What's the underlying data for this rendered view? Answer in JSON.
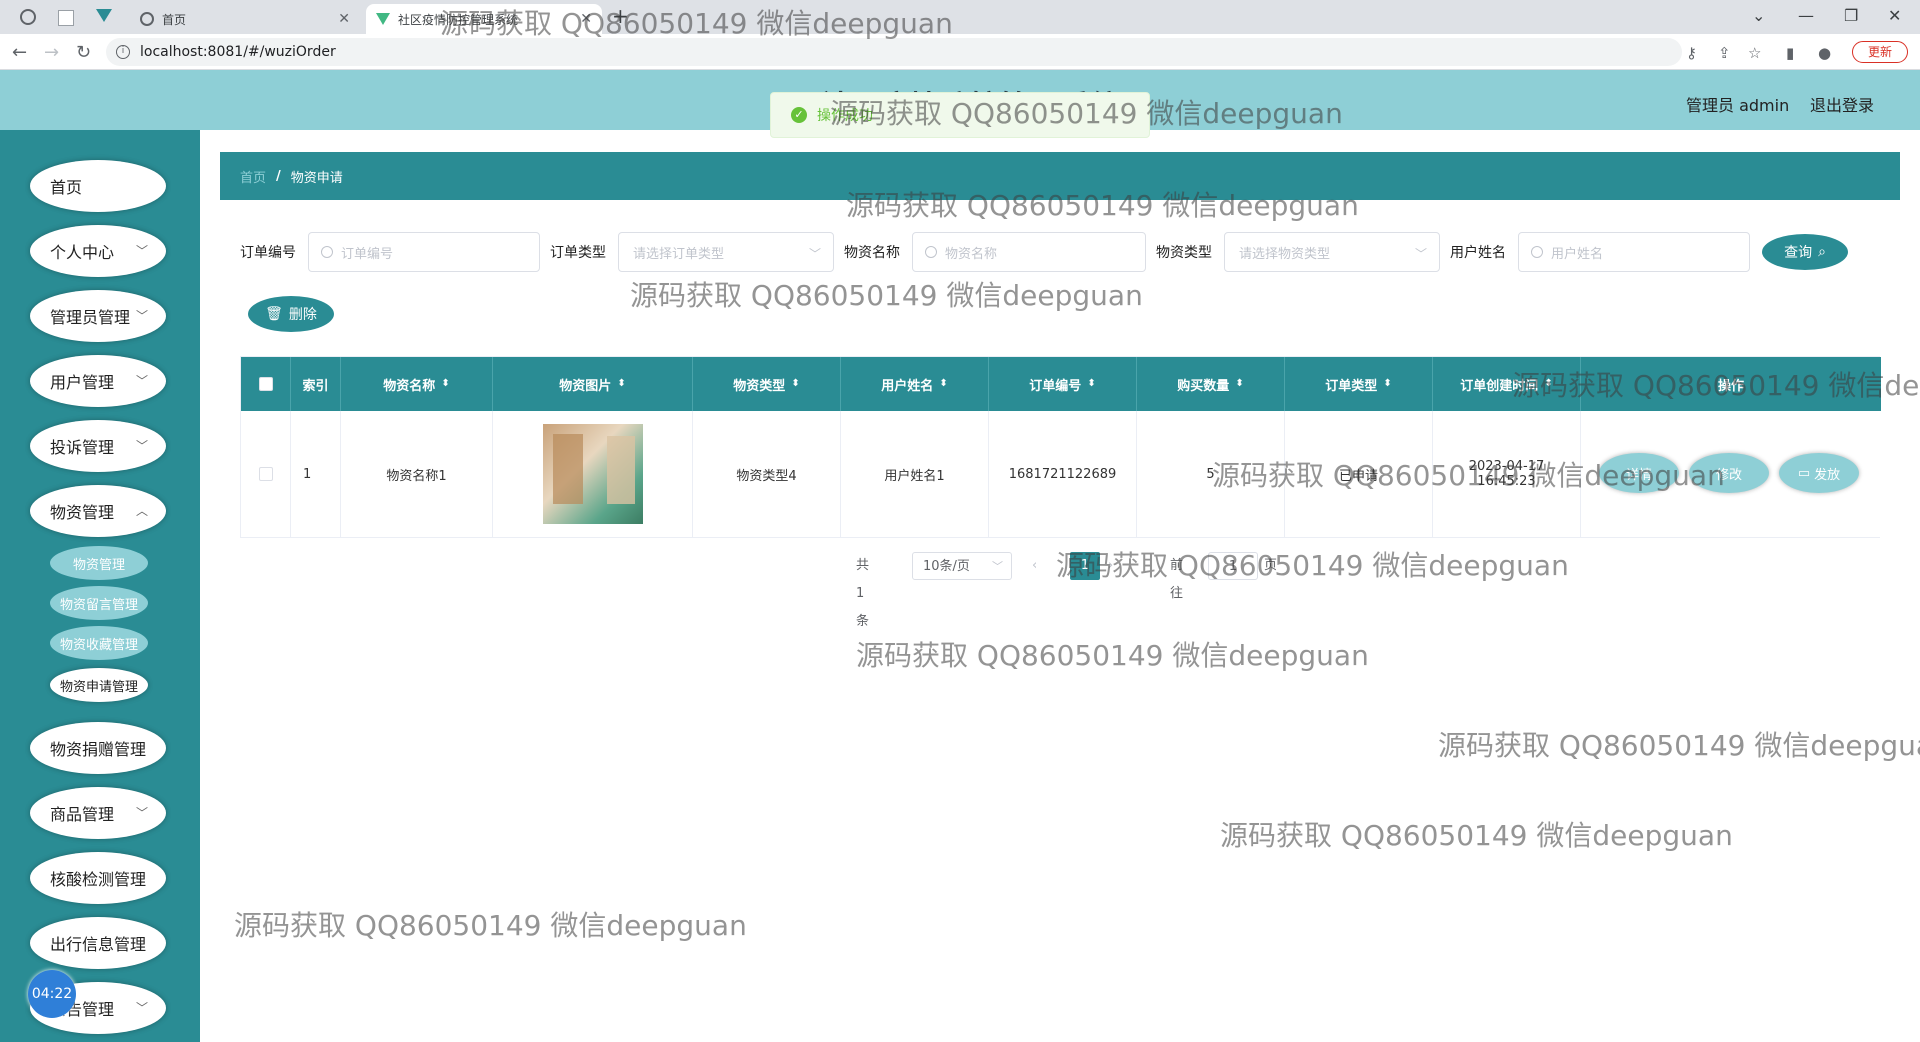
{
  "browser": {
    "tabs": [
      {
        "title": "首页"
      },
      {
        "title": "社区疫情防控管理系统"
      }
    ],
    "url": "localhost:8081/#/wuziOrder",
    "update_label": "更新"
  },
  "header": {
    "title": "社区疫情防控管理系统",
    "user": "管理员 admin",
    "logout": "退出登录"
  },
  "toast": {
    "text": "操作成功"
  },
  "sidebar": {
    "items": [
      {
        "label": "首页"
      },
      {
        "label": "个人中心"
      },
      {
        "label": "管理员管理"
      },
      {
        "label": "用户管理"
      },
      {
        "label": "投诉管理"
      },
      {
        "label": "物资管理"
      },
      {
        "label": "物资捐赠管理"
      },
      {
        "label": "商品管理"
      },
      {
        "label": "核酸检测管理"
      },
      {
        "label": "出行信息管理"
      },
      {
        "label": "公告管理"
      }
    ],
    "sub_items": [
      {
        "label": "物资管理"
      },
      {
        "label": "物资留言管理"
      },
      {
        "label": "物资收藏管理"
      },
      {
        "label": "物资申请管理"
      }
    ],
    "timer": "04:22"
  },
  "breadcrumb": {
    "home": "首页",
    "current": "物资申请"
  },
  "search": {
    "order_no_label": "订单编号",
    "order_no_placeholder": "订单编号",
    "order_type_label": "订单类型",
    "order_type_placeholder": "请选择订单类型",
    "goods_name_label": "物资名称",
    "goods_name_placeholder": "物资名称",
    "goods_type_label": "物资类型",
    "goods_type_placeholder": "请选择物资类型",
    "user_name_label": "用户姓名",
    "user_name_placeholder": "用户姓名",
    "query_label": "查询"
  },
  "actions": {
    "delete_label": "删除"
  },
  "table": {
    "columns": [
      "索引",
      "物资名称",
      "物资图片",
      "物资类型",
      "用户姓名",
      "订单编号",
      "购买数量",
      "订单类型",
      "订单创建时间",
      "操作"
    ],
    "rows": [
      {
        "index": "1",
        "name": "物资名称1",
        "type": "物资类型4",
        "user": "用户姓名1",
        "order_no": "1681721122689",
        "qty": "5",
        "order_type": "已申请",
        "created": "2023-04-17 16:45:23",
        "ops": [
          "详情",
          "修改",
          "发放"
        ]
      }
    ]
  },
  "pager": {
    "total": "共 1 条",
    "size": "10条/页",
    "page": "1",
    "goto": "前往",
    "goto_value": "1",
    "page_suffix": "页"
  },
  "watermark": "源码获取 QQ86050149 微信deepguan"
}
